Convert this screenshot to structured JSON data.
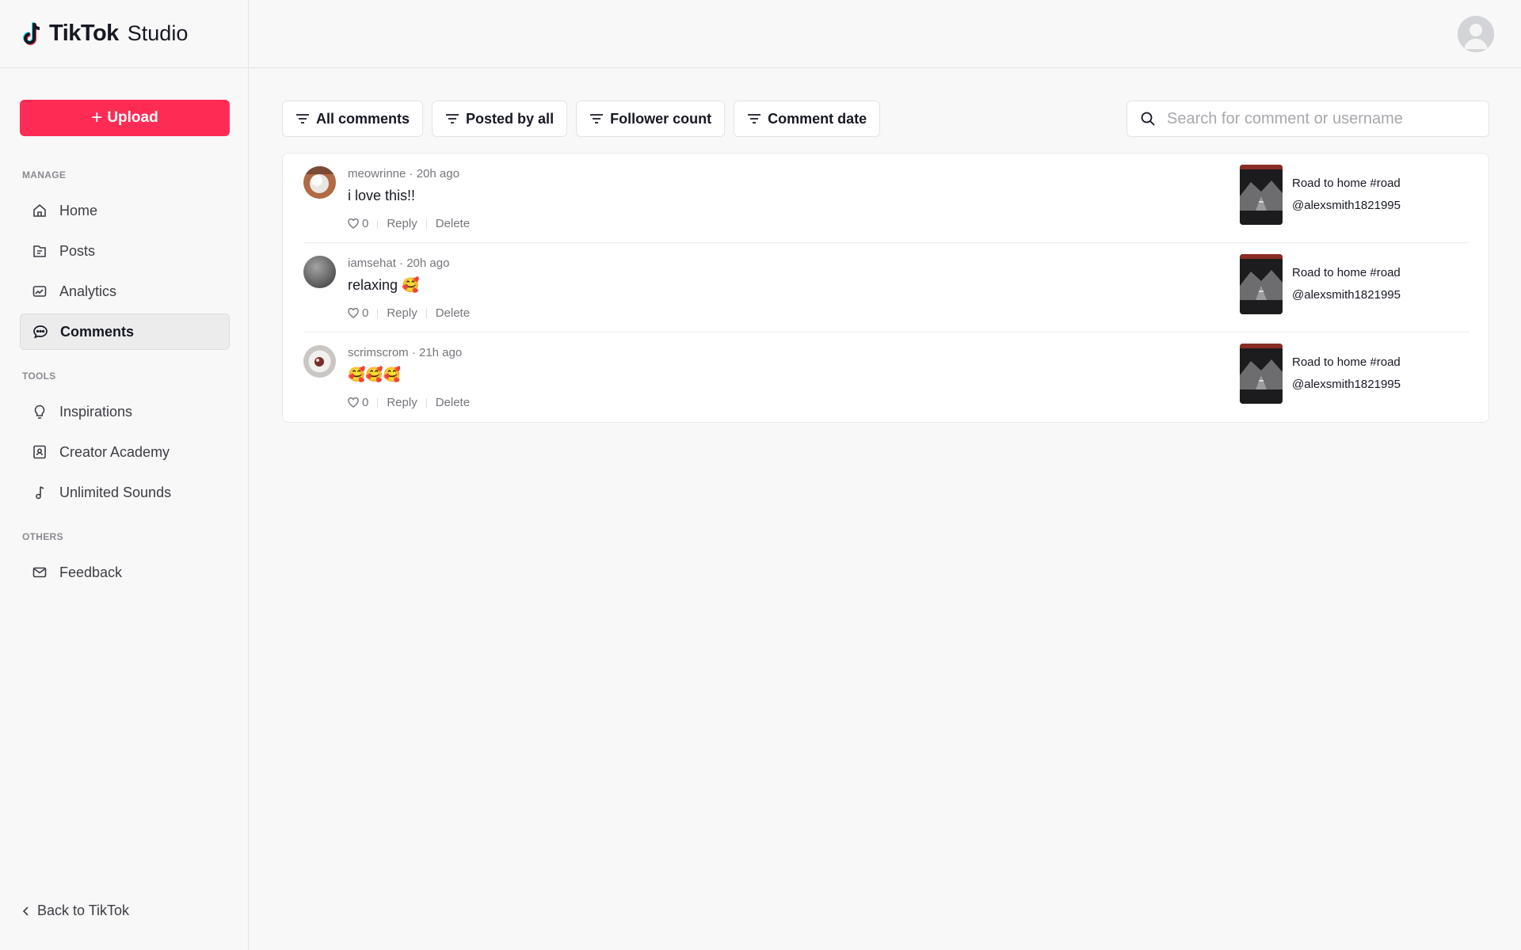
{
  "brand": {
    "name": "TikTok",
    "suffix": "Studio"
  },
  "sidebar": {
    "upload_label": "Upload",
    "sections": {
      "manage": "MANAGE",
      "tools": "TOOLS",
      "others": "OTHERS"
    },
    "manage_items": [
      {
        "label": "Home",
        "icon": "home-icon"
      },
      {
        "label": "Posts",
        "icon": "folder-icon"
      },
      {
        "label": "Analytics",
        "icon": "analytics-icon"
      },
      {
        "label": "Comments",
        "icon": "comment-icon",
        "active": true
      }
    ],
    "tools_items": [
      {
        "label": "Inspirations",
        "icon": "lightbulb-icon"
      },
      {
        "label": "Creator Academy",
        "icon": "academy-icon"
      },
      {
        "label": "Unlimited Sounds",
        "icon": "music-note-icon"
      }
    ],
    "others_items": [
      {
        "label": "Feedback",
        "icon": "mail-icon"
      }
    ],
    "back_label": "Back to TikTok"
  },
  "filters": [
    "All comments",
    "Posted by all",
    "Follower count",
    "Comment date"
  ],
  "search": {
    "placeholder": "Search for comment or username",
    "value": ""
  },
  "comments": [
    {
      "meta": "meowrinne · 20h ago",
      "text": "i love this!!",
      "likes": "0",
      "reply": "Reply",
      "delete": "Delete",
      "video_title": "Road to home #road",
      "video_author": "@alexsmith1821995"
    },
    {
      "meta": "iamsehat · 20h ago",
      "text": "relaxing 🥰",
      "likes": "0",
      "reply": "Reply",
      "delete": "Delete",
      "video_title": "Road to home #road",
      "video_author": "@alexsmith1821995"
    },
    {
      "meta": "scrimscrom · 21h ago",
      "text": "🥰🥰🥰",
      "likes": "0",
      "reply": "Reply",
      "delete": "Delete",
      "video_title": "Road to home #road",
      "video_author": "@alexsmith1821995"
    }
  ],
  "colors": {
    "accent": "#fe2c55",
    "text": "#161823",
    "muted": "#75767c"
  }
}
